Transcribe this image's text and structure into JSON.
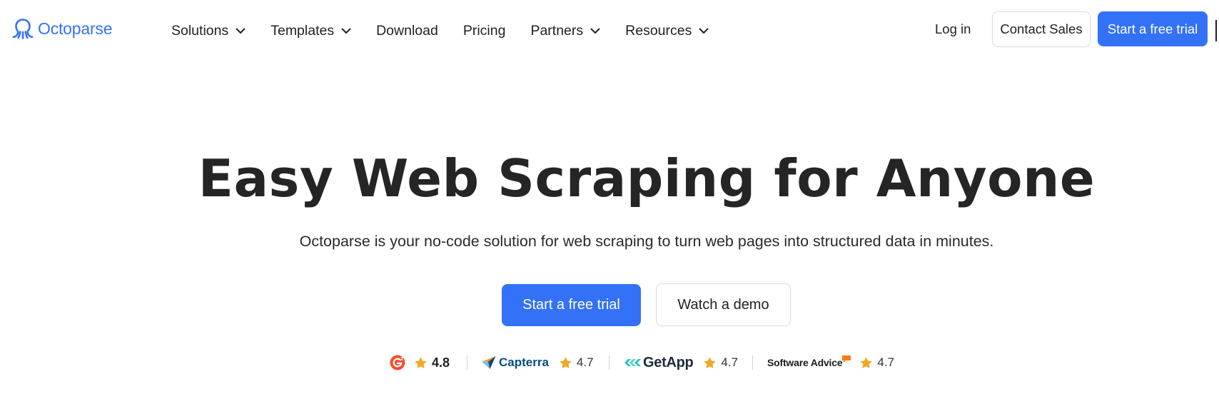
{
  "brand": {
    "name": "Octoparse",
    "color": "#3572f5"
  },
  "nav": {
    "items": [
      {
        "label": "Solutions",
        "has_dropdown": true
      },
      {
        "label": "Templates",
        "has_dropdown": true
      },
      {
        "label": "Download",
        "has_dropdown": false
      },
      {
        "label": "Pricing",
        "has_dropdown": false
      },
      {
        "label": "Partners",
        "has_dropdown": true
      },
      {
        "label": "Resources",
        "has_dropdown": true
      }
    ],
    "login": "Log in",
    "contact_sales": "Contact Sales",
    "start_trial": "Start a free trial"
  },
  "hero": {
    "title": "Easy Web Scraping for Anyone",
    "subtitle": "Octoparse is your no-code solution for web scraping to turn web pages into structured data in minutes.",
    "primary_cta": "Start a free trial",
    "secondary_cta": "Watch a demo"
  },
  "ratings": [
    {
      "source": "G2",
      "score": "4.8",
      "icon": "g2-logo-icon"
    },
    {
      "source": "Capterra",
      "score": "4.7",
      "icon": "capterra-logo-icon"
    },
    {
      "source": "GetApp",
      "score": "4.7",
      "icon": "getapp-logo-icon"
    },
    {
      "source": "Software Advice",
      "score": "4.7",
      "icon": "software-advice-logo-icon"
    }
  ],
  "colors": {
    "primary": "#3371f6",
    "star": "#f5a623",
    "g2": "#ff492c",
    "capterra_dark": "#044d80",
    "getapp_teal": "#27c4b6"
  }
}
